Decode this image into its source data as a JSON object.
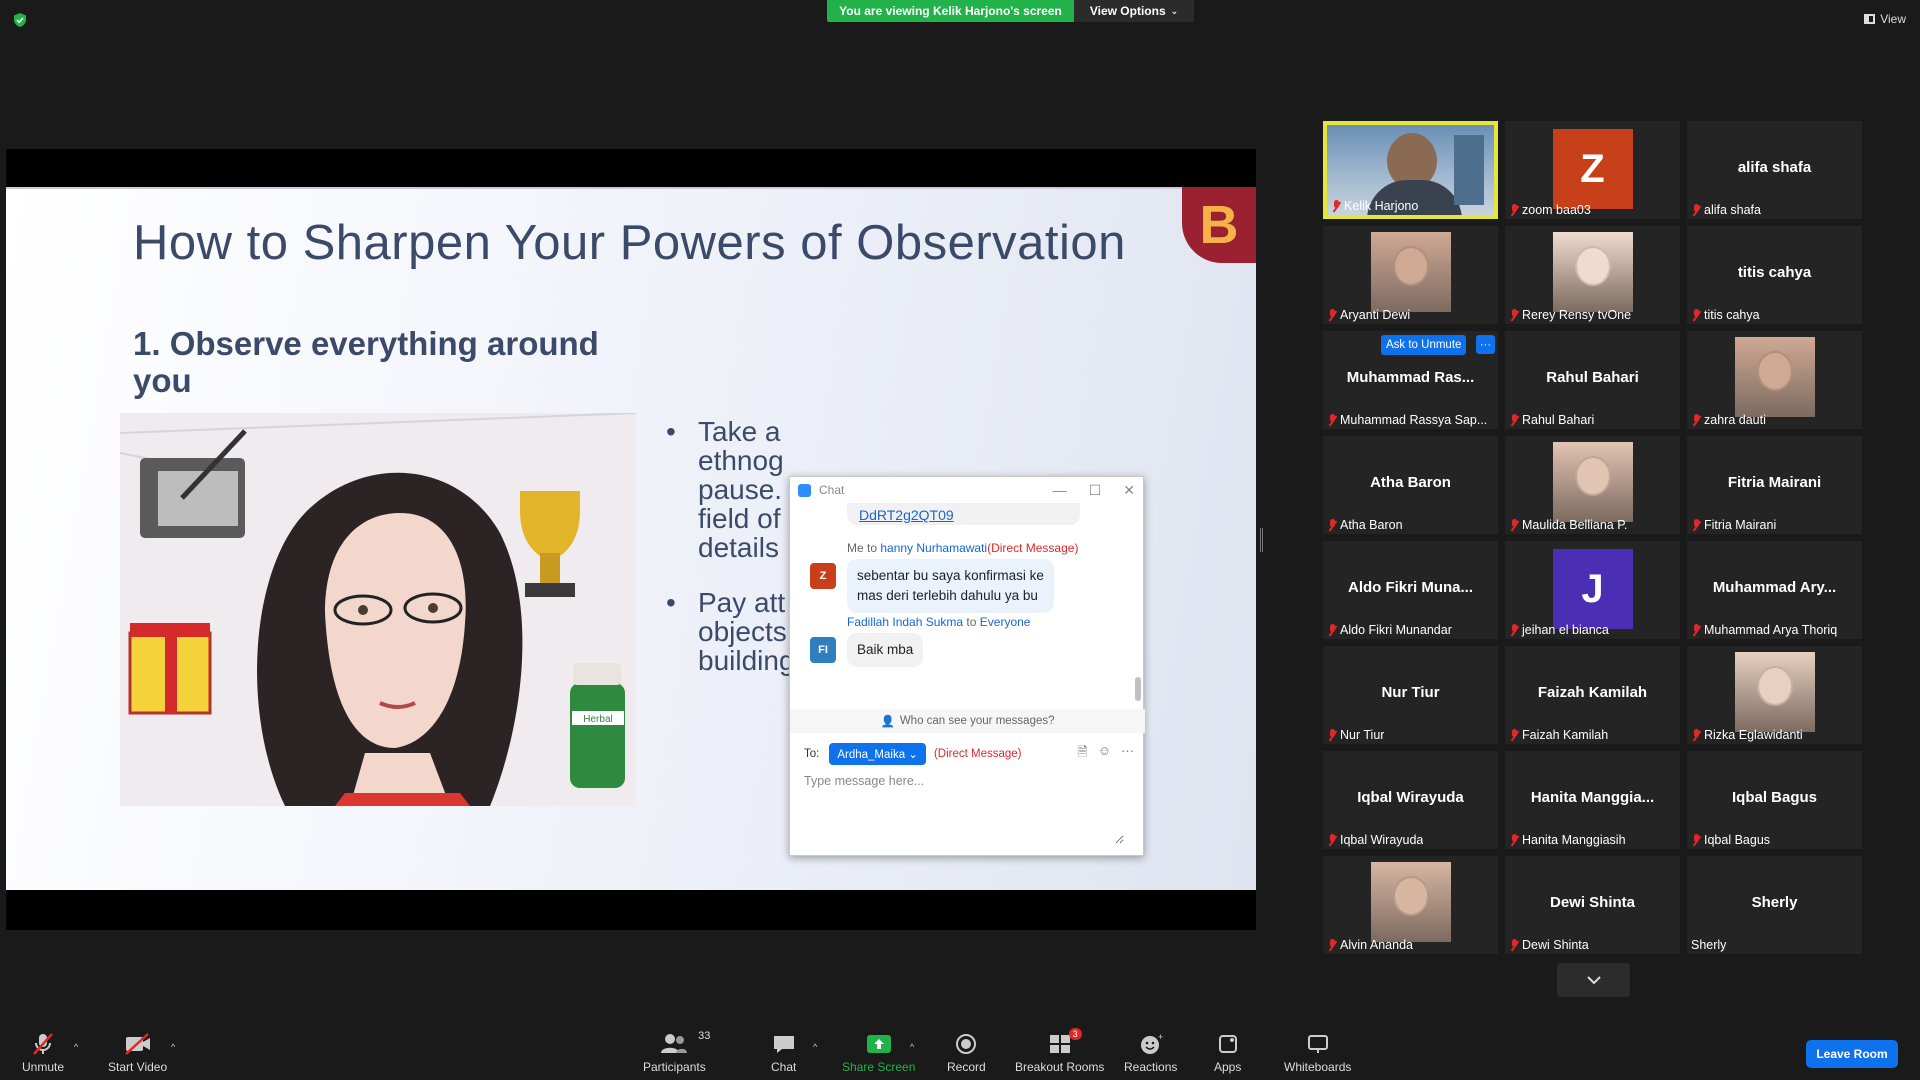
{
  "topbar": {
    "banner": "You are viewing Kelik Harjono's screen",
    "view_options": "View Options",
    "view": "View"
  },
  "slide": {
    "title": "How to Sharpen Your Powers of Observation",
    "subtitle": "1. Observe everything around you",
    "bullets": [
      "Take a",
      "ethnog",
      "pause.",
      "field of",
      "details",
      "Pay att",
      "objects",
      "building"
    ],
    "herbal_label": "Herbal",
    "logo_letter": "B"
  },
  "chat": {
    "title": "Chat",
    "link_text": "DdRT2g2QT09",
    "msg1": {
      "prefix": "Me to ",
      "recipient": "hanny Nurhamawati",
      "dm": "(Direct Message)",
      "avatar": "Z",
      "text_line1": "sebentar bu saya konfirmasi ke",
      "text_line2": "mas deri terlebih dahulu ya bu"
    },
    "msg2": {
      "sender": "Fadillah Indah Sukma",
      "to": " to ",
      "recipient": "Everyone",
      "avatar": "FI",
      "text": "Baik mba"
    },
    "who_can_see": "Who can see your messages?",
    "to_label": "To:",
    "to_recipient": "Ardha_Maika",
    "to_dm": "(Direct Message)",
    "input_placeholder": "Type message here..."
  },
  "gallery": {
    "tiles": [
      {
        "name": "Kelik Harjono",
        "big": "",
        "kind": "video"
      },
      {
        "name": "zoom baa03",
        "big": "",
        "kind": "letter",
        "letter": "Z",
        "color": "#c8401a"
      },
      {
        "name": "alifa shafa",
        "big": "alifa shafa",
        "kind": "name"
      },
      {
        "name": "Aryanti Dewi",
        "big": "",
        "kind": "photo"
      },
      {
        "name": "Rerey Rensy tvOne",
        "big": "",
        "kind": "photo"
      },
      {
        "name": "titis cahya",
        "big": "titis cahya",
        "kind": "name"
      },
      {
        "name": "Muhammad Rassya Sap...",
        "big": "Muhammad Ras...",
        "kind": "name"
      },
      {
        "name": "Rahul Bahari",
        "big": "Rahul Bahari",
        "kind": "name"
      },
      {
        "name": "zahra dauti",
        "big": "",
        "kind": "photo"
      },
      {
        "name": "Atha Baron",
        "big": "Atha Baron",
        "kind": "name"
      },
      {
        "name": "Maulida Belliana P.",
        "big": "",
        "kind": "photo"
      },
      {
        "name": "Fitria Mairani",
        "big": "Fitria Mairani",
        "kind": "name"
      },
      {
        "name": "Aldo Fikri Munandar",
        "big": "Aldo Fikri Muna...",
        "kind": "name"
      },
      {
        "name": "jeihan el bianca",
        "big": "",
        "kind": "letter",
        "letter": "J",
        "color": "#4a2fb5"
      },
      {
        "name": "Muhammad Arya Thoriq",
        "big": "Muhammad Ary...",
        "kind": "name"
      },
      {
        "name": "Nur Tiur",
        "big": "Nur Tiur",
        "kind": "name"
      },
      {
        "name": "Faizah Kamilah",
        "big": "Faizah Kamilah",
        "kind": "name"
      },
      {
        "name": "Rizka Eglawidanti",
        "big": "",
        "kind": "photo"
      },
      {
        "name": "Iqbal Wirayuda",
        "big": "Iqbal Wirayuda",
        "kind": "name"
      },
      {
        "name": "Hanita Manggiasih",
        "big": "Hanita Manggia...",
        "kind": "name"
      },
      {
        "name": "Iqbal Bagus",
        "big": "Iqbal Bagus",
        "kind": "name"
      },
      {
        "name": "Alvin Ananda",
        "big": "",
        "kind": "photo"
      },
      {
        "name": "Dewi Shinta",
        "big": "Dewi Shinta",
        "kind": "name"
      },
      {
        "name": "Sherly",
        "big": "Sherly",
        "kind": "name"
      }
    ],
    "ask_to_unmute": "Ask to Unmute",
    "more": "···"
  },
  "toolbar": {
    "unmute": "Unmute",
    "start_video": "Start Video",
    "participants": "Participants",
    "participants_count": "33",
    "chat": "Chat",
    "share_screen": "Share Screen",
    "record": "Record",
    "breakout_rooms": "Breakout Rooms",
    "breakout_badge": "3",
    "reactions": "Reactions",
    "apps": "Apps",
    "whiteboards": "Whiteboards",
    "leave_room": "Leave Room"
  },
  "colors": {
    "accent": "#0e72ed",
    "banner_green": "#21b24a",
    "active_speaker": "#e5e63a",
    "muted_red": "#e02828"
  }
}
